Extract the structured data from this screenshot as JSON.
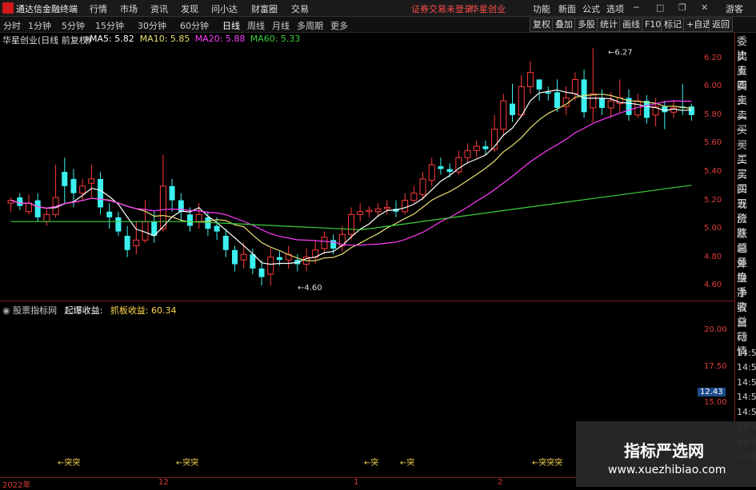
{
  "app": {
    "title": "通达信金融终端"
  },
  "menu": [
    "行情",
    "市场",
    "资讯",
    "发现",
    "问小达",
    "财富圈",
    "交易"
  ],
  "notice": [
    "证券交易未登录",
    "华星创业"
  ],
  "right_menu": [
    "功能",
    "新面",
    "公式",
    "选项",
    "游客"
  ],
  "periods": [
    "分时",
    "1分钟",
    "5分钟",
    "15分钟",
    "30分钟",
    "60分钟",
    "日线",
    "周线",
    "月线",
    "多周期",
    "更多"
  ],
  "active_period": "日线",
  "tools": [
    "复权",
    "叠加",
    "多股",
    "统计",
    "画线",
    "F10",
    "标记",
    "+自选",
    "返回"
  ],
  "chart": {
    "title": "华星创业(日线 前复权)",
    "ma": [
      {
        "label": "MA5: 5.82",
        "color": "#ffffff"
      },
      {
        "label": "MA10: 5.85",
        "color": "#e8e070"
      },
      {
        "label": "MA20: 5.88",
        "color": "#ff3cff"
      },
      {
        "label": "MA60: 5.33",
        "color": "#3cd03c"
      }
    ],
    "y_ticks": [
      "6.20",
      "6.00",
      "5.80",
      "5.60",
      "5.40",
      "5.20",
      "5.00",
      "4.80",
      "4.60"
    ],
    "high_label": "6.27",
    "low_label": "4.60"
  },
  "sub": {
    "title": "股票指标网",
    "ind1": "起爆收益:",
    "ind2": "抓板收益: 60.34",
    "y_ticks": [
      "20.00",
      "17.50",
      "15.00",
      "12.50",
      "10.00"
    ],
    "current_value": "12.43",
    "signals": [
      "突突",
      "突突",
      "突",
      "突",
      "突突突"
    ]
  },
  "right_panel": [
    "委比",
    "卖五",
    "卖四",
    "卖三",
    "卖二",
    "卖一",
    "买一",
    "买二",
    "买三",
    "买四",
    "买五",
    "现价",
    "涨跌",
    "涨幅",
    "总量",
    "外盘",
    "换手",
    "净资",
    "收益",
    "自动",
    "行情",
    "14:50",
    "14:50",
    "14:50",
    "14:50",
    "14:50",
    "14:50",
    "14:50",
    "14:50"
  ],
  "x_labels": [
    "2022年",
    "12",
    "1",
    "2"
  ],
  "watermark": {
    "line1": "指标严选网",
    "line2": "www.xuezhibiao.com"
  },
  "chart_data": {
    "type": "candlestick",
    "y_range": [
      4.5,
      6.3
    ],
    "candles": [
      [
        5.18,
        5.2,
        5.12,
        5.22
      ],
      [
        5.22,
        5.16,
        5.13,
        5.25
      ],
      [
        5.12,
        5.18,
        5.1,
        5.24
      ],
      [
        5.2,
        5.08,
        5.05,
        5.25
      ],
      [
        5.05,
        5.1,
        5.02,
        5.15
      ],
      [
        5.1,
        5.22,
        5.08,
        5.45
      ],
      [
        5.4,
        5.3,
        5.18,
        5.5
      ],
      [
        5.35,
        5.25,
        5.15,
        5.42
      ],
      [
        5.25,
        5.3,
        5.2,
        5.35
      ],
      [
        5.32,
        5.35,
        5.22,
        5.45
      ],
      [
        5.35,
        5.15,
        5.1,
        5.4
      ],
      [
        5.12,
        5.08,
        5.0,
        5.18
      ],
      [
        5.08,
        4.98,
        4.95,
        5.12
      ],
      [
        4.95,
        4.85,
        4.8,
        5.02
      ],
      [
        4.88,
        4.92,
        4.82,
        5.05
      ],
      [
        4.92,
        5.05,
        4.9,
        5.2
      ],
      [
        5.05,
        4.95,
        4.9,
        5.12
      ],
      [
        5.0,
        5.3,
        4.98,
        5.52
      ],
      [
        5.3,
        5.2,
        5.12,
        5.35
      ],
      [
        5.2,
        5.12,
        5.05,
        5.25
      ],
      [
        5.1,
        5.02,
        4.98,
        5.15
      ],
      [
        5.05,
        5.1,
        5.0,
        5.18
      ],
      [
        5.08,
        5.0,
        4.95,
        5.12
      ],
      [
        5.02,
        4.98,
        4.92,
        5.08
      ],
      [
        4.95,
        4.85,
        4.8,
        5.0
      ],
      [
        4.85,
        4.75,
        4.7,
        4.88
      ],
      [
        4.78,
        4.82,
        4.72,
        4.9
      ],
      [
        4.82,
        4.72,
        4.68,
        4.86
      ],
      [
        4.72,
        4.66,
        4.6,
        4.78
      ],
      [
        4.68,
        4.8,
        4.6,
        4.86
      ],
      [
        4.8,
        4.78,
        4.74,
        4.84
      ],
      [
        4.78,
        4.82,
        4.72,
        4.88
      ],
      [
        4.78,
        4.75,
        4.7,
        4.82
      ],
      [
        4.75,
        4.8,
        4.7,
        4.86
      ],
      [
        4.8,
        4.85,
        4.75,
        4.92
      ],
      [
        4.86,
        4.94,
        4.82,
        4.98
      ],
      [
        4.92,
        4.86,
        4.82,
        4.96
      ],
      [
        4.88,
        4.96,
        4.84,
        5.02
      ],
      [
        4.96,
        5.1,
        4.92,
        5.15
      ],
      [
        5.1,
        5.12,
        5.05,
        5.18
      ],
      [
        5.12,
        5.13,
        5.08,
        5.16
      ],
      [
        5.12,
        5.14,
        5.08,
        5.18
      ],
      [
        5.14,
        5.15,
        5.1,
        5.2
      ],
      [
        5.14,
        5.12,
        5.08,
        5.2
      ],
      [
        5.12,
        5.2,
        5.1,
        5.25
      ],
      [
        5.2,
        5.25,
        5.18,
        5.3
      ],
      [
        5.24,
        5.35,
        5.2,
        5.4
      ],
      [
        5.34,
        5.45,
        5.3,
        5.5
      ],
      [
        5.44,
        5.42,
        5.38,
        5.5
      ],
      [
        5.42,
        5.4,
        5.36,
        5.46
      ],
      [
        5.4,
        5.5,
        5.38,
        5.55
      ],
      [
        5.5,
        5.55,
        5.46,
        5.6
      ],
      [
        5.55,
        5.58,
        5.5,
        5.62
      ],
      [
        5.58,
        5.56,
        5.52,
        5.62
      ],
      [
        5.56,
        5.7,
        5.54,
        5.8
      ],
      [
        5.7,
        5.9,
        5.65,
        5.95
      ],
      [
        5.88,
        5.8,
        5.75,
        6.02
      ],
      [
        5.8,
        6.0,
        5.78,
        6.08
      ],
      [
        6.0,
        6.1,
        5.95,
        6.18
      ],
      [
        6.05,
        5.98,
        5.9,
        6.05
      ],
      [
        5.96,
        5.95,
        5.9,
        6.0
      ],
      [
        5.96,
        5.85,
        5.82,
        6.05
      ],
      [
        5.86,
        5.92,
        5.8,
        6.0
      ],
      [
        5.95,
        6.05,
        5.9,
        6.1
      ],
      [
        6.05,
        5.82,
        5.78,
        6.12
      ],
      [
        5.85,
        5.95,
        5.75,
        6.27
      ],
      [
        5.92,
        5.85,
        5.8,
        5.98
      ],
      [
        5.85,
        5.9,
        5.78,
        5.96
      ],
      [
        5.88,
        5.92,
        5.82,
        6.05
      ],
      [
        5.92,
        5.8,
        5.76,
        5.98
      ],
      [
        5.8,
        5.9,
        5.78,
        5.95
      ],
      [
        5.9,
        5.78,
        5.74,
        5.94
      ],
      [
        5.8,
        5.86,
        5.72,
        5.92
      ],
      [
        5.86,
        5.82,
        5.7,
        5.9
      ],
      [
        5.82,
        5.85,
        5.78,
        5.9
      ],
      [
        5.86,
        5.85,
        5.8,
        6.02
      ],
      [
        5.86,
        5.8,
        5.76,
        5.88
      ]
    ],
    "sub_values": [
      10.6,
      10.6,
      10.6,
      10.6,
      10.6,
      10.6,
      10.6,
      10.6,
      10.6,
      10.6,
      12.43
    ]
  }
}
